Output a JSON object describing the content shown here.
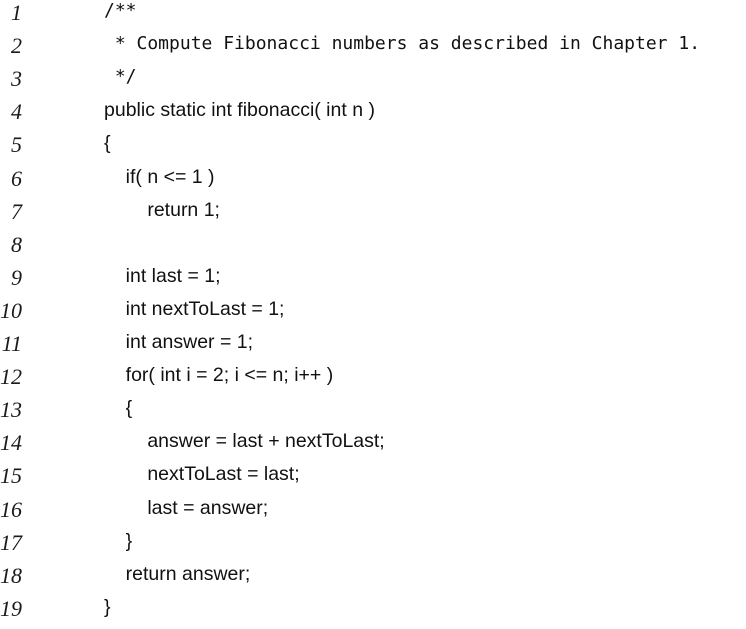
{
  "listing": {
    "lines": [
      {
        "number": "1",
        "text": "/**"
      },
      {
        "number": "2",
        "text": " * Compute Fibonacci numbers as described in Chapter 1."
      },
      {
        "number": "3",
        "text": " */"
      },
      {
        "number": "4",
        "text": "public static int fibonacci( int n )"
      },
      {
        "number": "5",
        "text": "{"
      },
      {
        "number": "6",
        "text": "    if( n <= 1 )"
      },
      {
        "number": "7",
        "text": "        return 1;"
      },
      {
        "number": "8",
        "text": ""
      },
      {
        "number": "9",
        "text": "    int last = 1;"
      },
      {
        "number": "10",
        "text": "    int nextToLast = 1;"
      },
      {
        "number": "11",
        "text": "    int answer = 1;"
      },
      {
        "number": "12",
        "text": "    for( int i = 2; i <= n; i++ )"
      },
      {
        "number": "13",
        "text": "    {"
      },
      {
        "number": "14",
        "text": "        answer = last + nextToLast;"
      },
      {
        "number": "15",
        "text": "        nextToLast = last;"
      },
      {
        "number": "16",
        "text": "        last = answer;"
      },
      {
        "number": "17",
        "text": "    }"
      },
      {
        "number": "18",
        "text": "    return answer;"
      },
      {
        "number": "19",
        "text": "}"
      }
    ]
  }
}
